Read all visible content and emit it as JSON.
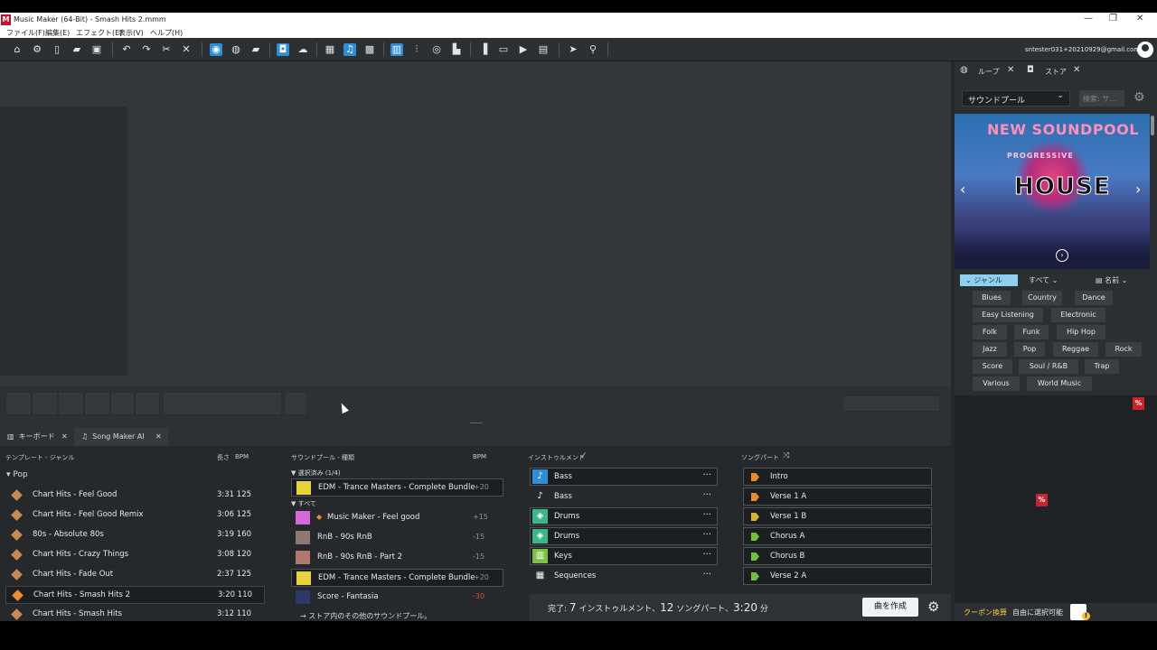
{
  "window": {
    "title": "Music Maker (64-Bit) - Smash Hits 2.mmm",
    "logo": "M",
    "controls": [
      "—",
      "❐",
      "✕"
    ]
  },
  "menu": [
    "ファイル(F)",
    "編集(E)",
    "エフェクト(E)",
    "表示(V)",
    "ヘルプ(H)"
  ],
  "user": {
    "email": "sntester031+20210929@gmail.com"
  },
  "side": {
    "tabs": [
      {
        "label": "ループ",
        "icon": "loops-icon"
      },
      {
        "label": "ストア",
        "icon": "store-bag-icon"
      }
    ],
    "pool_select": "サウンドプール",
    "search_placeholder": "検索: サ...",
    "banner": {
      "title": "NEW SOUNDPOOL",
      "sub": "PROGRESSIVE",
      "main": "HOUSE"
    },
    "filter": {
      "genre": "ジャンル",
      "all": "すべて",
      "sort": "名前"
    },
    "genres": [
      "Blues",
      "Country",
      "Dance",
      "Easy Listening",
      "Electronic",
      "Folk",
      "Funk",
      "Hip Hop",
      "Jazz",
      "Pop",
      "Reggae",
      "Rock",
      "Score",
      "Soul / R&B",
      "Trap",
      "Various",
      "World Music"
    ],
    "badge": "%",
    "footer": {
      "coupon": "クーポン換算",
      "selectable": "自由に選択可能"
    }
  },
  "bottom_tabs": [
    {
      "label": "キーボード",
      "icon": "keyboard-icon"
    },
    {
      "label": "Song Maker AI",
      "icon": "music-note-icon"
    }
  ],
  "songmaker": {
    "headers": {
      "template": "テンプレート - ジャンル",
      "length": "長さ",
      "bpm": "BPM",
      "pool": "サウンドプール - 種類",
      "pool_bpm": "BPM",
      "instruments": "インストゥルメント",
      "parts": "ソングパート"
    },
    "genre_group": "Pop",
    "templates": [
      {
        "name": "Chart Hits - Feel Good",
        "length": "3:31",
        "bpm": "125"
      },
      {
        "name": "Chart Hits - Feel Good Remix",
        "length": "3:06",
        "bpm": "125"
      },
      {
        "name": "80s - Absolute 80s",
        "length": "3:19",
        "bpm": "160"
      },
      {
        "name": "Chart Hits - Crazy Things",
        "length": "3:08",
        "bpm": "120"
      },
      {
        "name": "Chart Hits - Fade Out",
        "length": "2:37",
        "bpm": "125"
      },
      {
        "name": "Chart Hits - Smash Hits 2",
        "length": "3:20",
        "bpm": "110"
      },
      {
        "name": "Chart Hits - Smash Hits",
        "length": "3:12",
        "bpm": "110"
      }
    ],
    "pool_selected_label": "▼ 選択済み (1/4)",
    "pool_all_label": "▼ すべて",
    "pools_selected": [
      {
        "name": "EDM - Trance Masters - Complete Bundle",
        "bpm": "+20"
      }
    ],
    "pools": [
      {
        "name": "Music Maker - Feel good",
        "bpm": "+15"
      },
      {
        "name": "RnB - 90s RnB",
        "bpm": "-15"
      },
      {
        "name": "RnB - 90s RnB - Part 2",
        "bpm": "-15"
      },
      {
        "name": "EDM - Trance Masters - Complete Bundle",
        "bpm": "+20"
      },
      {
        "name": "Score - Fantasia",
        "bpm": "-30"
      }
    ],
    "more_pools": "→ ストア内のその他のサウンドプール。",
    "instruments": [
      {
        "name": "Bass",
        "more": "···"
      },
      {
        "name": "Bass",
        "more": "···"
      },
      {
        "name": "Drums",
        "more": "···"
      },
      {
        "name": "Drums",
        "more": "···"
      },
      {
        "name": "Keys",
        "more": "···"
      },
      {
        "name": "Sequences",
        "more": "···"
      }
    ],
    "parts": [
      {
        "name": "Intro",
        "color": "#e98a2c"
      },
      {
        "name": "Verse 1 A",
        "color": "#e98a2c"
      },
      {
        "name": "Verse 1 B",
        "color": "#d9b22a"
      },
      {
        "name": "Chorus A",
        "color": "#6cc23a"
      },
      {
        "name": "Chorus B",
        "color": "#6cc23a"
      },
      {
        "name": "Verse 2 A",
        "color": "#6cc23a"
      }
    ],
    "status": {
      "prefix": "完了: ",
      "inst_count": "7",
      "inst_label": " インストゥルメント、",
      "part_count": "12",
      "part_label": " ソングパート、",
      "duration": "3:20",
      "duration_unit": " 分"
    },
    "create_label": "曲を作成"
  },
  "colors": {
    "accent": "#2f8fd6",
    "selected_template": "#ef8a2e",
    "coupon": "#f4d43a",
    "badge": "#d0202c"
  }
}
